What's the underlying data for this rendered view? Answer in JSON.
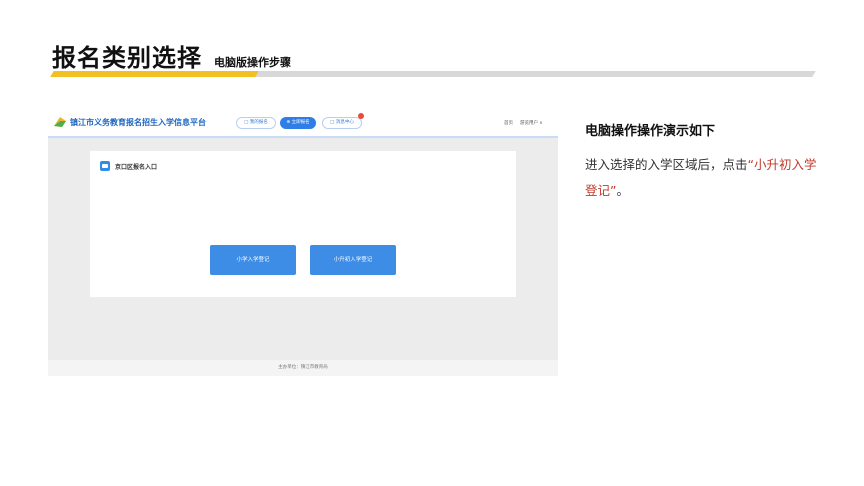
{
  "slide": {
    "title": "报名类别选择",
    "subtitle": "电脑版操作步骤"
  },
  "colors": {
    "accent_yellow": "#f2c020",
    "brand_blue": "#1f66c1",
    "highlight_red": "#c0392b"
  },
  "screenshot": {
    "site_title": "镇江市义务教育报名招生入学信息平台",
    "nav_tabs": [
      {
        "label": "□ 我的报名",
        "active": false
      },
      {
        "label": "⊕ 立即报名",
        "active": true
      },
      {
        "label": "□ 消息中心",
        "active": false
      }
    ],
    "header_links": {
      "home": "首页",
      "user": "游览用户 ∨"
    },
    "card_title": "京口区报名入口",
    "buttons": {
      "primary": "小学入学登记",
      "junior": "小升初入学登记"
    },
    "footer": "主办单位：镇江市教育局"
  },
  "instructions": {
    "title": "电脑操作操作演示如下",
    "body_prefix": "进入选择的入学区域后，点击",
    "body_highlight": "“小升初入学登记”",
    "body_suffix": "。"
  }
}
